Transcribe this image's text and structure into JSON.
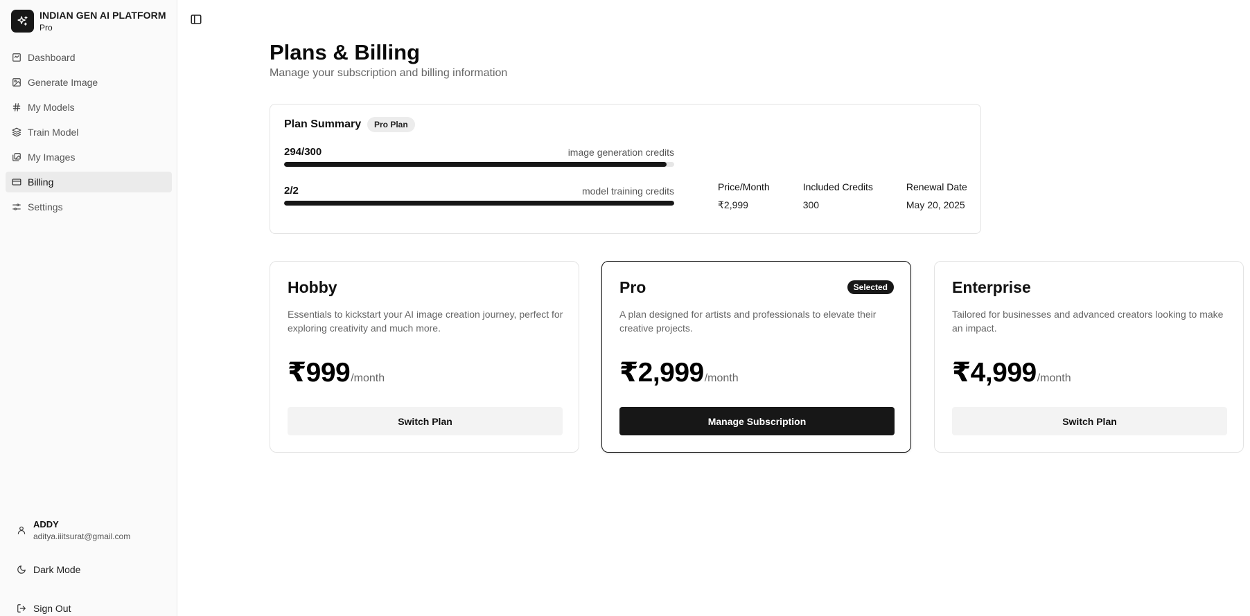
{
  "brand": {
    "name": "INDIAN GEN AI PLATFORM",
    "plan": "Pro",
    "icon": "sparkles-icon"
  },
  "sidebar": {
    "items": [
      {
        "label": "Dashboard",
        "icon": "dashboard-icon",
        "active": false
      },
      {
        "label": "Generate Image",
        "icon": "image-icon",
        "active": false
      },
      {
        "label": "My Models",
        "icon": "hash-icon",
        "active": false
      },
      {
        "label": "Train Model",
        "icon": "layers-icon",
        "active": false
      },
      {
        "label": "My Images",
        "icon": "images-icon",
        "active": false
      },
      {
        "label": "Billing",
        "icon": "credit-card-icon",
        "active": true
      },
      {
        "label": "Settings",
        "icon": "sliders-icon",
        "active": false
      }
    ]
  },
  "user": {
    "name": "ADDY",
    "email": "aditya.iiitsurat@gmail.com"
  },
  "actions": {
    "dark_mode": "Dark Mode",
    "sign_out": "Sign Out"
  },
  "header": {
    "title": "Plans & Billing",
    "subtitle": "Manage your subscription and billing information"
  },
  "summary": {
    "title": "Plan Summary",
    "badge": "Pro Plan",
    "image_credits": {
      "count": "294/300",
      "label": "image generation credits",
      "used": 294,
      "total": 300
    },
    "training_credits": {
      "count": "2/2",
      "label": "model training credits",
      "used": 2,
      "total": 2
    },
    "stats": [
      {
        "label": "Price/Month",
        "value": "₹2,999"
      },
      {
        "label": "Included Credits",
        "value": "300"
      },
      {
        "label": "Renewal Date",
        "value": "May 20, 2025"
      }
    ]
  },
  "plans": [
    {
      "name": "Hobby",
      "description": "Essentials to kickstart your AI image creation journey, perfect for exploring creativity and much more.",
      "price": "₹999",
      "period": "/month",
      "button": "Switch Plan",
      "selected": false
    },
    {
      "name": "Pro",
      "badge": "Selected",
      "description": "A plan designed for artists and professionals to elevate their creative projects.",
      "price": "₹2,999",
      "period": "/month",
      "button": "Manage Subscription",
      "selected": true
    },
    {
      "name": "Enterprise",
      "description": "Tailored for businesses and advanced creators looking to make an impact.",
      "price": "₹4,999",
      "period": "/month",
      "button": "Switch Plan",
      "selected": false
    }
  ],
  "colors": {
    "accent": "#171717",
    "sidebar_bg": "#fafafa",
    "active_item_bg": "#ebebeb",
    "muted_text": "#666666"
  }
}
